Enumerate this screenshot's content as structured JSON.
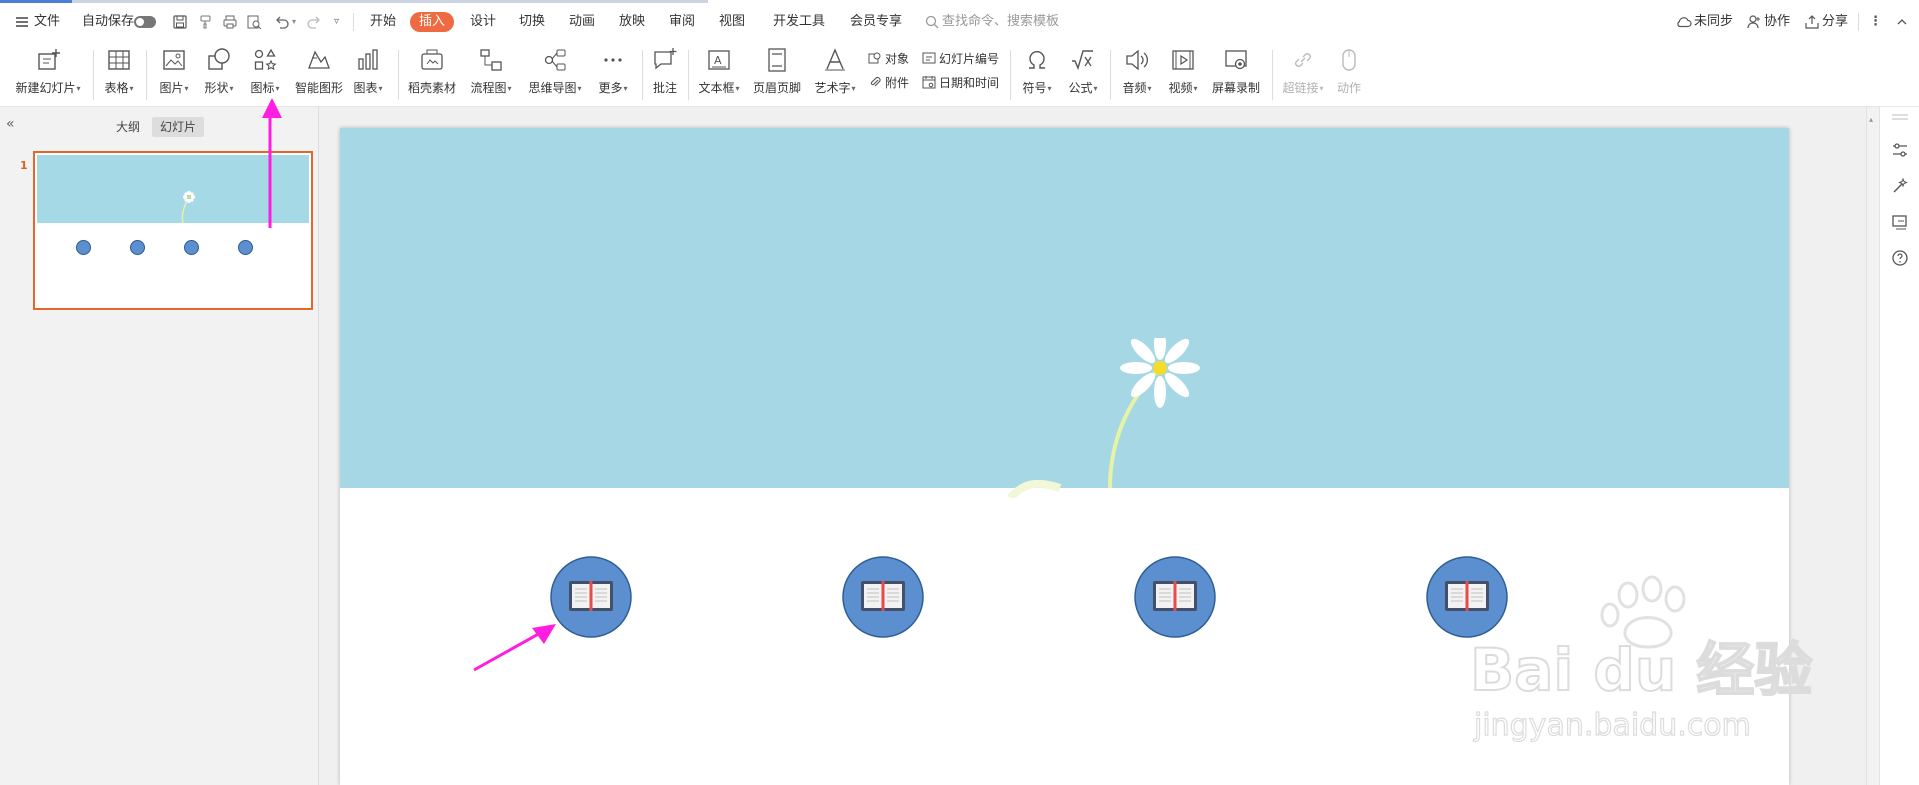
{
  "menubar": {
    "file": "文件",
    "autosave": "自动保存",
    "tabs": [
      "开始",
      "插入",
      "设计",
      "切换",
      "动画",
      "放映",
      "审阅",
      "视图",
      "开发工具",
      "会员专享"
    ],
    "active_tab": "插入",
    "search_placeholder": "查找命令、搜索模板",
    "sync": "未同步",
    "collab": "协作",
    "share": "分享"
  },
  "ribbon": {
    "new_slide": "新建幻灯片",
    "table": "表格",
    "picture": "图片",
    "shape": "形状",
    "icon": "图标",
    "smart_art": "智能图形",
    "chart": "图表",
    "docer": "稻壳素材",
    "flowchart": "流程图",
    "mindmap": "思维导图",
    "more": "更多",
    "comment": "批注",
    "textbox": "文本框",
    "header_footer": "页眉页脚",
    "wordart": "艺术字",
    "object": "对象",
    "attachment": "附件",
    "slide_number": "幻灯片编号",
    "datetime": "日期和时间",
    "symbol": "符号",
    "formula": "公式",
    "audio": "音频",
    "video": "视频",
    "screen_record": "屏幕录制",
    "hyperlink": "超链接",
    "action": "动作"
  },
  "panel": {
    "outline_tab": "大纲",
    "slides_tab": "幻灯片",
    "slide_number": "1"
  },
  "slide": {
    "banner_color": "#a5d8e4",
    "icon_circle_color": "#5b8fcf",
    "icon_count": 4
  },
  "colors": {
    "accent": "#f06a41",
    "annotation_arrow": "#ff1ee0",
    "selection_border": "#e8662c"
  },
  "watermark": {
    "brand": "Bai du 经验",
    "url": "jingyan.baidu.com"
  }
}
